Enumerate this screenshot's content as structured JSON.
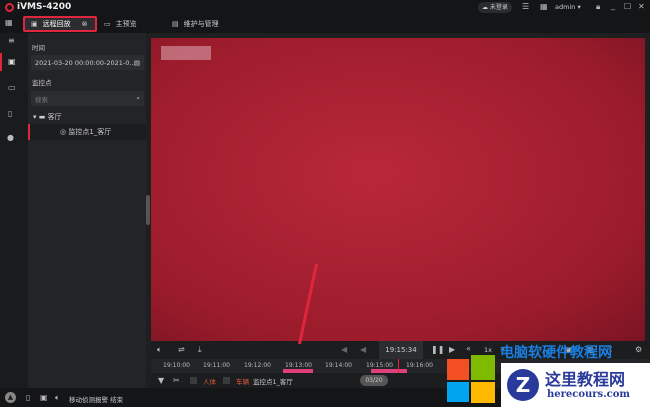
{
  "app": {
    "title": "iVMS-4200",
    "cloud_status": "未登录",
    "user": "admin"
  },
  "tabs": [
    {
      "label": "远程回放",
      "active": true
    },
    {
      "label": "主预览"
    },
    {
      "label": "维护与管理"
    }
  ],
  "panel": {
    "time_label": "时间",
    "time_value": "2021-03-20 00:00:00-2021-0...",
    "camera_label": "监控点",
    "search_placeholder": "搜索",
    "group": "客厅",
    "camera": "监控点1_客厅"
  },
  "controls": {
    "current_time": "19:15:34",
    "speed": "1x"
  },
  "timeline": {
    "ticks": [
      "19:10:00",
      "19:11:00",
      "19:12:00",
      "19:13:00",
      "19:14:00",
      "19:15:00",
      "19:16:00"
    ]
  },
  "filter": {
    "human": "人体",
    "vehicle": "车辆",
    "camera": "监控点1_客厅",
    "date": "03/20"
  },
  "status": {
    "message": "移动侦测报警 结束"
  },
  "watermark": {
    "site_cn": "这里教程网",
    "site_url": "herecours.com",
    "banner": "电脑软硬件教程网"
  },
  "colors": {
    "accent": "#e0263c",
    "highlight": "#e0407a"
  }
}
